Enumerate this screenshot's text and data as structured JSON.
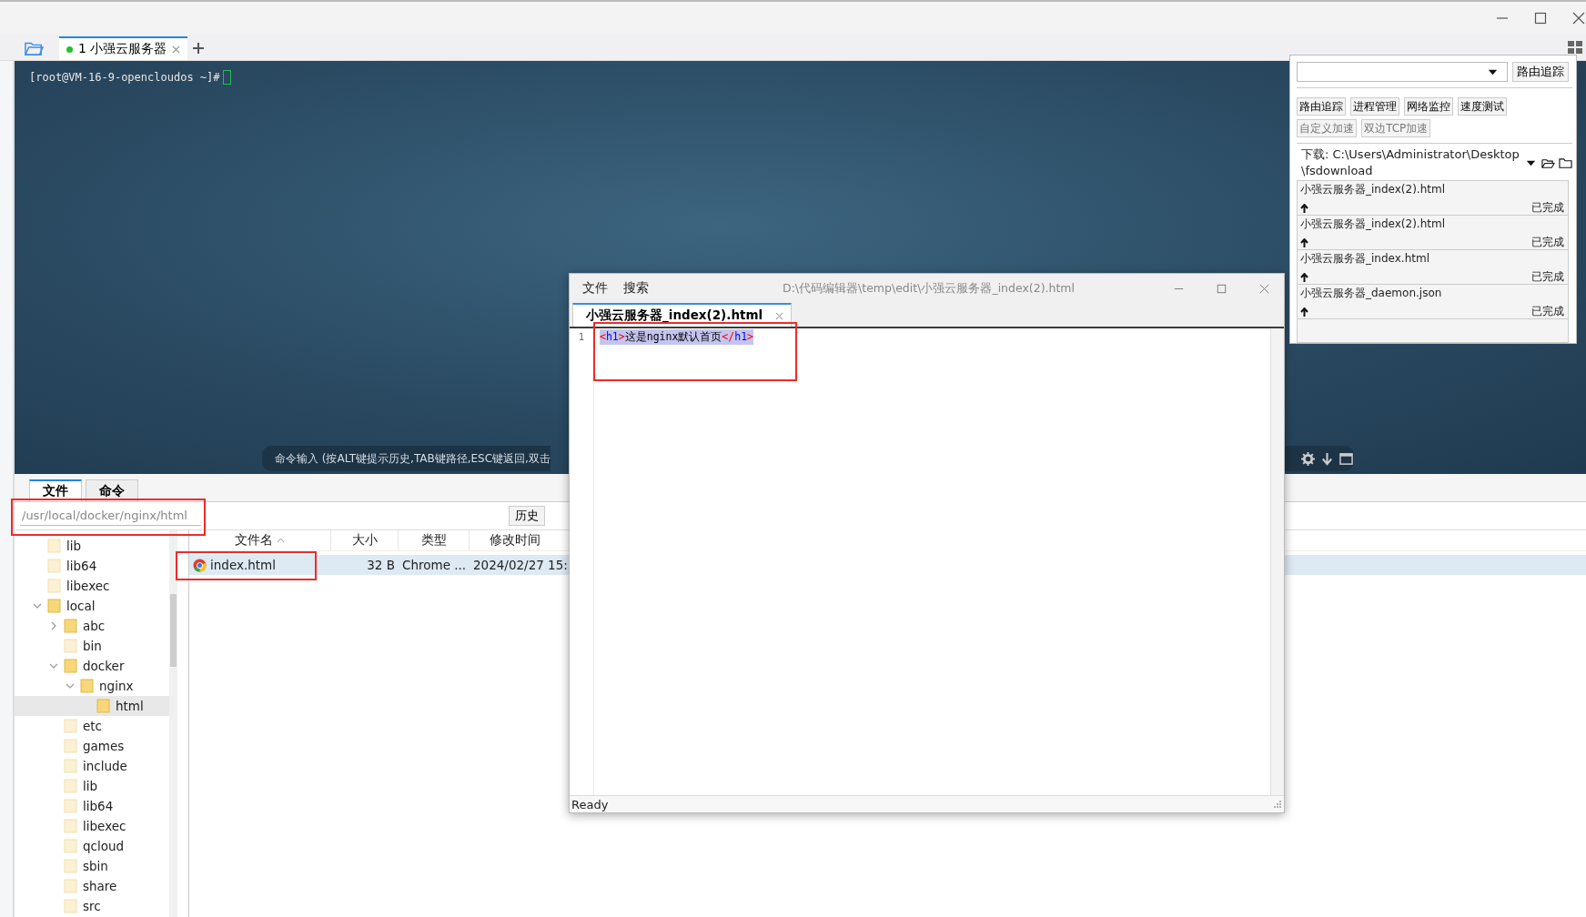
{
  "app_tabs": [
    {
      "label": "1 小强云服务器",
      "selected": true,
      "connected": true
    }
  ],
  "terminal": {
    "prompt": "[root@VM-16-9-opencloudos ~]#",
    "command_hint": "命令输入 (按ALT键提示历史,TAB键路径,ESC键返回,双击"
  },
  "panel_tabs": [
    {
      "label": "文件",
      "selected": true
    },
    {
      "label": "命令",
      "selected": false
    }
  ],
  "path_field": {
    "value": "/usr/local/docker/nginx/html"
  },
  "history_button": "历史",
  "tree": [
    {
      "label": "lib",
      "loaded": false,
      "selected": false
    },
    {
      "label": "lib64",
      "loaded": false,
      "selected": false
    },
    {
      "label": "libexec",
      "loaded": false,
      "selected": false
    },
    {
      "label": "local",
      "expanded": true,
      "loaded": true,
      "selected": false,
      "children": [
        {
          "label": "abc",
          "expanded": false,
          "loaded": true,
          "selected": false
        },
        {
          "label": "bin",
          "loaded": false,
          "selected": false
        },
        {
          "label": "docker",
          "expanded": true,
          "loaded": true,
          "selected": false,
          "children": [
            {
              "label": "nginx",
              "expanded": true,
              "loaded": true,
              "selected": false,
              "children": [
                {
                  "label": "html",
                  "loaded": true,
                  "selected": true
                }
              ]
            }
          ]
        },
        {
          "label": "etc",
          "loaded": false,
          "selected": false
        },
        {
          "label": "games",
          "loaded": false,
          "selected": false
        },
        {
          "label": "include",
          "loaded": false,
          "selected": false
        },
        {
          "label": "lib",
          "loaded": false,
          "selected": false
        },
        {
          "label": "lib64",
          "loaded": false,
          "selected": false
        },
        {
          "label": "libexec",
          "loaded": false,
          "selected": false
        },
        {
          "label": "qcloud",
          "loaded": false,
          "selected": false
        },
        {
          "label": "sbin",
          "loaded": false,
          "selected": false
        },
        {
          "label": "share",
          "loaded": false,
          "selected": false
        },
        {
          "label": "src",
          "loaded": false,
          "selected": false
        }
      ]
    }
  ],
  "file_list": {
    "columns": [
      {
        "label": "文件名",
        "sorted": true
      },
      {
        "label": "大小",
        "sorted": false
      },
      {
        "label": "类型",
        "sorted": false
      },
      {
        "label": "修改时间",
        "sorted": false
      }
    ],
    "rows": [
      {
        "cells": [
          "index.html",
          "32 B",
          "Chrome ...",
          "2024/02/27 15:"
        ],
        "selected": true
      }
    ]
  },
  "editor": {
    "menu": [
      "文件",
      "搜索"
    ],
    "title": "D:\\代码编辑器\\temp\\edit\\小强云服务器_index(2).html",
    "tabs": [
      {
        "label": "小强云服务器_index(2).html",
        "selected": true
      }
    ],
    "lines": [
      {
        "number": "1",
        "selected": true,
        "tokens": [
          {
            "text": "<",
            "kind": "bracket"
          },
          {
            "text": "h1",
            "kind": "tag"
          },
          {
            "text": ">",
            "kind": "bracket"
          },
          {
            "text": "这是nginx默认首页",
            "kind": "text"
          },
          {
            "text": "</",
            "kind": "bracket"
          },
          {
            "text": "h1",
            "kind": "tag"
          },
          {
            "text": ">",
            "kind": "bracket"
          }
        ]
      }
    ],
    "status": "Ready"
  },
  "network_panel": {
    "trace_button": "路由追踪",
    "tools": [
      {
        "label": "路由追踪",
        "disabled": false
      },
      {
        "label": "进程管理",
        "disabled": false
      },
      {
        "label": "网络监控",
        "disabled": false
      },
      {
        "label": "速度测试",
        "disabled": false
      },
      {
        "label": "自定义加速",
        "disabled": true
      },
      {
        "label": "双边TCP加速",
        "disabled": true
      }
    ],
    "download_label": "下载: C:\\Users\\Administrator\\Desktop\\fsdownload",
    "transfers": [
      {
        "name": "小强云服务器_index(2).html",
        "status": "已完成"
      },
      {
        "name": "小强云服务器_index(2).html",
        "status": "已完成"
      },
      {
        "name": "小强云服务器_index.html",
        "status": "已完成"
      },
      {
        "name": "小强云服务器_daemon.json",
        "status": "已完成"
      }
    ]
  }
}
